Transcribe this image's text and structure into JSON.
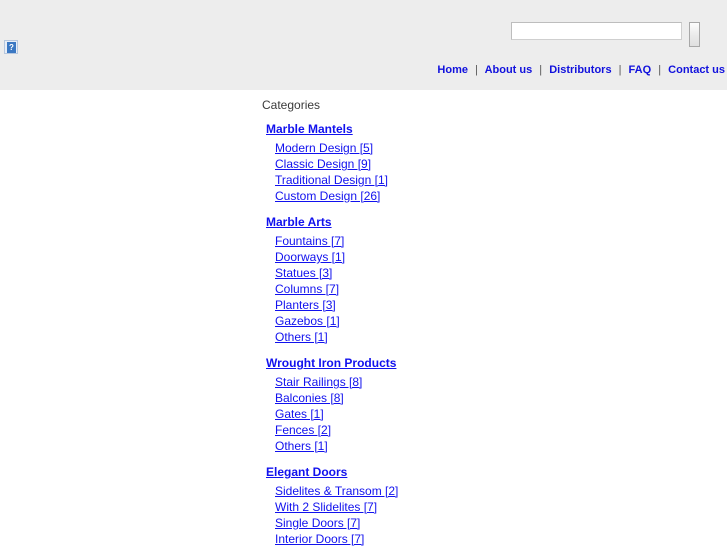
{
  "header": {
    "logo": {
      "alt_glyph": "?",
      "icon": "broken-image-icon"
    },
    "search": {
      "value": "",
      "placeholder": "",
      "submit_label": ""
    },
    "nav": {
      "separator": "|",
      "items": [
        {
          "label": "Home"
        },
        {
          "label": "About us"
        },
        {
          "label": "Distributors"
        },
        {
          "label": "FAQ"
        },
        {
          "label": "Contact us"
        }
      ]
    }
  },
  "main": {
    "title": "Categories",
    "categories": [
      {
        "name": "Marble Mantels",
        "items": [
          {
            "label": "Modern Design [5]"
          },
          {
            "label": "Classic Design [9]"
          },
          {
            "label": "Traditional Design [1]"
          },
          {
            "label": "Custom Design [26]"
          }
        ]
      },
      {
        "name": "Marble Arts",
        "items": [
          {
            "label": "Fountains [7]"
          },
          {
            "label": "Doorways [1]"
          },
          {
            "label": "Statues [3]"
          },
          {
            "label": "Columns [7]"
          },
          {
            "label": "Planters [3]"
          },
          {
            "label": "Gazebos [1]"
          },
          {
            "label": "Others [1]"
          }
        ]
      },
      {
        "name": "Wrought Iron Products",
        "items": [
          {
            "label": "Stair Railings [8]"
          },
          {
            "label": "Balconies [8]"
          },
          {
            "label": "Gates [1]"
          },
          {
            "label": "Fences [2]"
          },
          {
            "label": "Others [1]"
          }
        ]
      },
      {
        "name": "Elegant Doors",
        "items": [
          {
            "label": "Sidelites & Transom [2]"
          },
          {
            "label": "With 2 Slidelites [7]"
          },
          {
            "label": "Single Doors [7]"
          },
          {
            "label": "Interior Doors [7]"
          }
        ]
      }
    ]
  },
  "colors": {
    "header_background": "#ededed",
    "page_background": "#ffffff",
    "link": "#1111ee",
    "nav_link": "#1111dd",
    "title_text": "#3a3a3a"
  }
}
